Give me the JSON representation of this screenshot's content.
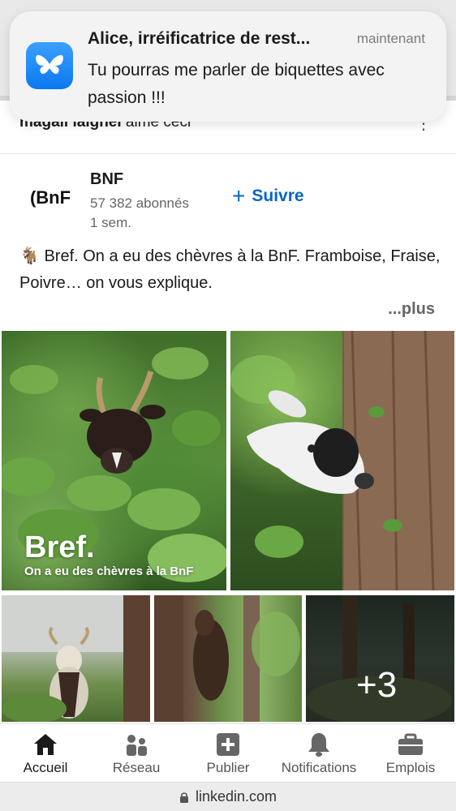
{
  "notification": {
    "title": "Alice, irréificatrice de rest...",
    "time": "maintenant",
    "body": "Tu pourras me parler de biquettes avec passion !!!"
  },
  "feed": {
    "liked_by_name": "magali laignel",
    "liked_by_action": " aime ceci",
    "more_menu": "⋮"
  },
  "post": {
    "author_logo": "(BnF",
    "author_name": "BNF",
    "followers": "57 382  abonnés",
    "time": "1 sem.",
    "follow_label": "Suivre",
    "text": "🐐 Bref. On a eu des chèvres à la BnF. Framboise, Fraise, Poivre… on vous explique.",
    "see_more": "...plus",
    "image_overlay_title": "Bref.",
    "image_overlay_subtitle": "On a eu des chèvres à la BnF",
    "extra_images": "+3"
  },
  "bottom_nav": {
    "items": [
      {
        "label": "Accueil",
        "icon": "home-icon"
      },
      {
        "label": "Réseau",
        "icon": "network-icon"
      },
      {
        "label": "Publier",
        "icon": "post-plus-icon"
      },
      {
        "label": "Notifications",
        "icon": "bell-icon"
      },
      {
        "label": "Emplois",
        "icon": "briefcase-icon"
      }
    ]
  },
  "browser": {
    "url": "linkedin.com"
  },
  "colors": {
    "accent": "#0a66c2",
    "bluesky": "#0a78f0"
  }
}
